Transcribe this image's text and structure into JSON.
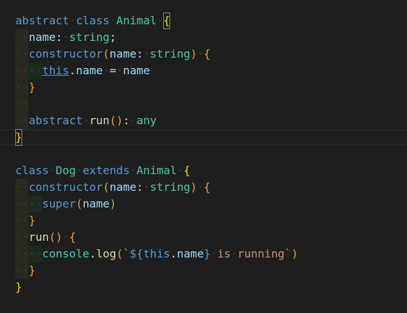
{
  "editor": {
    "language": "typescript",
    "lines": [
      [
        [
          "abstract",
          "kw"
        ],
        [
          " ",
          "ws"
        ],
        [
          "class",
          "kw"
        ],
        [
          " ",
          "ws"
        ],
        [
          "Animal",
          "cls"
        ],
        [
          " ",
          "ws"
        ],
        [
          "{",
          "b1 match"
        ]
      ],
      [
        [
          "  ",
          "ws ind1"
        ],
        [
          "name",
          "prop"
        ],
        [
          ":",
          "punc"
        ],
        [
          " ",
          "ws"
        ],
        [
          "string",
          "type"
        ],
        [
          ";",
          "punc"
        ]
      ],
      [
        [
          "  ",
          "ws ind1"
        ],
        [
          "constructor",
          "kw"
        ],
        [
          "(",
          "b2"
        ],
        [
          "name",
          "var"
        ],
        [
          ":",
          "punc"
        ],
        [
          " ",
          "ws"
        ],
        [
          "string",
          "type"
        ],
        [
          ")",
          "b2"
        ],
        [
          " ",
          "ws"
        ],
        [
          "{",
          "b2"
        ]
      ],
      [
        [
          "  ",
          "ws ind1"
        ],
        [
          "  ",
          "ws ind2"
        ],
        [
          "this",
          "this"
        ],
        [
          ".",
          "punc"
        ],
        [
          "name",
          "prop"
        ],
        [
          " ",
          "ws"
        ],
        [
          "=",
          "punc"
        ],
        [
          " ",
          "ws"
        ],
        [
          "name",
          "var"
        ]
      ],
      [
        [
          "  ",
          "ws ind1"
        ],
        [
          "}",
          "b2"
        ]
      ],
      [
        [
          "  ",
          "ws ind1"
        ]
      ],
      [
        [
          "  ",
          "ws ind1"
        ],
        [
          "abstract",
          "kw"
        ],
        [
          " ",
          "ws"
        ],
        [
          "run",
          "fn"
        ],
        [
          "(",
          "b2"
        ],
        [
          ")",
          "b2"
        ],
        [
          ":",
          "punc"
        ],
        [
          " ",
          "ws"
        ],
        [
          "any",
          "type"
        ]
      ],
      [
        [
          "}",
          "b1 match"
        ]
      ],
      [],
      [
        [
          "class",
          "kw"
        ],
        [
          " ",
          "ws"
        ],
        [
          "Dog",
          "cls"
        ],
        [
          " ",
          "ws"
        ],
        [
          "extends",
          "kw"
        ],
        [
          " ",
          "ws"
        ],
        [
          "Animal",
          "cls"
        ],
        [
          " ",
          "ws"
        ],
        [
          "{",
          "b1"
        ]
      ],
      [
        [
          "  ",
          "ws ind1"
        ],
        [
          "constructor",
          "kw"
        ],
        [
          "(",
          "b2"
        ],
        [
          "name",
          "var"
        ],
        [
          ":",
          "punc"
        ],
        [
          " ",
          "ws"
        ],
        [
          "string",
          "type"
        ],
        [
          ")",
          "b2"
        ],
        [
          " ",
          "ws"
        ],
        [
          "{",
          "b2"
        ]
      ],
      [
        [
          "  ",
          "ws ind1"
        ],
        [
          "  ",
          "ws ind2"
        ],
        [
          "super",
          "kw"
        ],
        [
          "(",
          "b2"
        ],
        [
          "name",
          "var"
        ],
        [
          ")",
          "b2"
        ]
      ],
      [
        [
          "  ",
          "ws ind1"
        ],
        [
          "}",
          "b2"
        ]
      ],
      [
        [
          "  ",
          "ws ind1"
        ],
        [
          "run",
          "fn"
        ],
        [
          "(",
          "b2"
        ],
        [
          ")",
          "b2"
        ],
        [
          " ",
          "ws"
        ],
        [
          "{",
          "b2"
        ]
      ],
      [
        [
          "  ",
          "ws ind1"
        ],
        [
          "  ",
          "ws ind2"
        ],
        [
          "console",
          "cls"
        ],
        [
          ".",
          "punc"
        ],
        [
          "log",
          "fn"
        ],
        [
          "(",
          "b3"
        ],
        [
          "`",
          "str"
        ],
        [
          "${",
          "kw"
        ],
        [
          "this",
          "kw"
        ],
        [
          ".",
          "punc"
        ],
        [
          "name",
          "prop"
        ],
        [
          "}",
          "kw"
        ],
        [
          " ",
          "ws"
        ],
        [
          "is",
          "str"
        ],
        [
          " ",
          "ws"
        ],
        [
          "running",
          "str"
        ],
        [
          "`",
          "str"
        ],
        [
          ")",
          "b3"
        ]
      ],
      [
        [
          "  ",
          "ws ind1"
        ],
        [
          "}",
          "b2"
        ]
      ],
      [
        [
          "}",
          "b1"
        ]
      ]
    ],
    "current_line": 7
  }
}
